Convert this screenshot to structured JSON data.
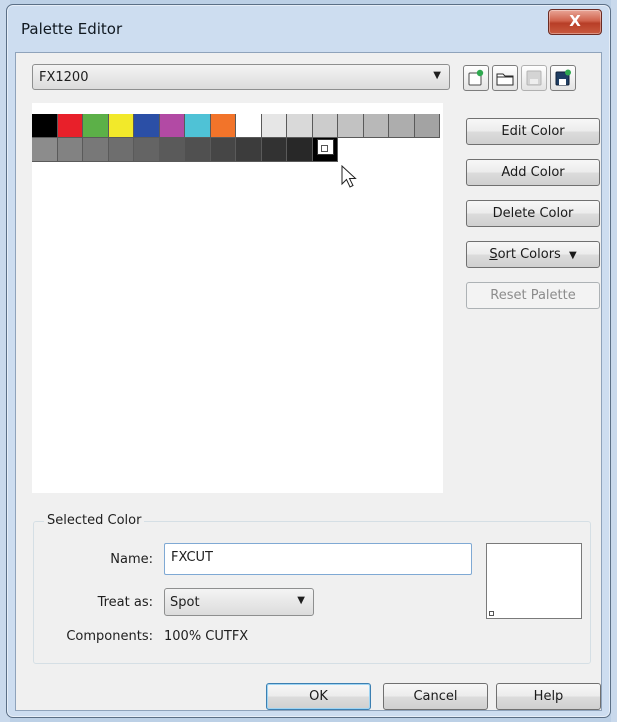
{
  "window": {
    "title": "Palette Editor",
    "close_label": "X"
  },
  "palette_select": {
    "value": "FX1200"
  },
  "toolbar": {
    "icons": [
      "new-palette-icon",
      "open-palette-icon",
      "save-palette-icon",
      "save-as-palette-icon"
    ]
  },
  "swatches": {
    "row1": [
      "#000000",
      "#e8202a",
      "#5cb048",
      "#f2e92a",
      "#2b4fa6",
      "#b24aa4",
      "#4fc2d6",
      "#f2742a",
      "#ffffff",
      "#e6e6e6",
      "#d9d9d9",
      "#cccccc",
      "#c2c2c2",
      "#b8b8b8",
      "#adadad",
      "#a3a3a3"
    ],
    "row2": [
      "#8c8c8c",
      "#828282",
      "#787878",
      "#6e6e6e",
      "#646464",
      "#5a5a5a",
      "#505050",
      "#464646",
      "#3c3c3c",
      "#323232",
      "#282828",
      "#000000"
    ]
  },
  "buttons": {
    "edit_color": "Edit Color",
    "add_color": "Add Color",
    "delete_color": "Delete Color",
    "sort_colors_prefix": "S",
    "sort_colors_rest": "ort Colors",
    "reset_palette": "Reset Palette"
  },
  "selected_color": {
    "legend": "Selected Color",
    "name_label": "Name:",
    "name_value": "FXCUT",
    "treat_label": "Treat as:",
    "treat_value": "Spot",
    "components_label": "Components:",
    "components_value": "100% CUTFX"
  },
  "footer": {
    "ok": "OK",
    "cancel": "Cancel",
    "help": "Help"
  }
}
